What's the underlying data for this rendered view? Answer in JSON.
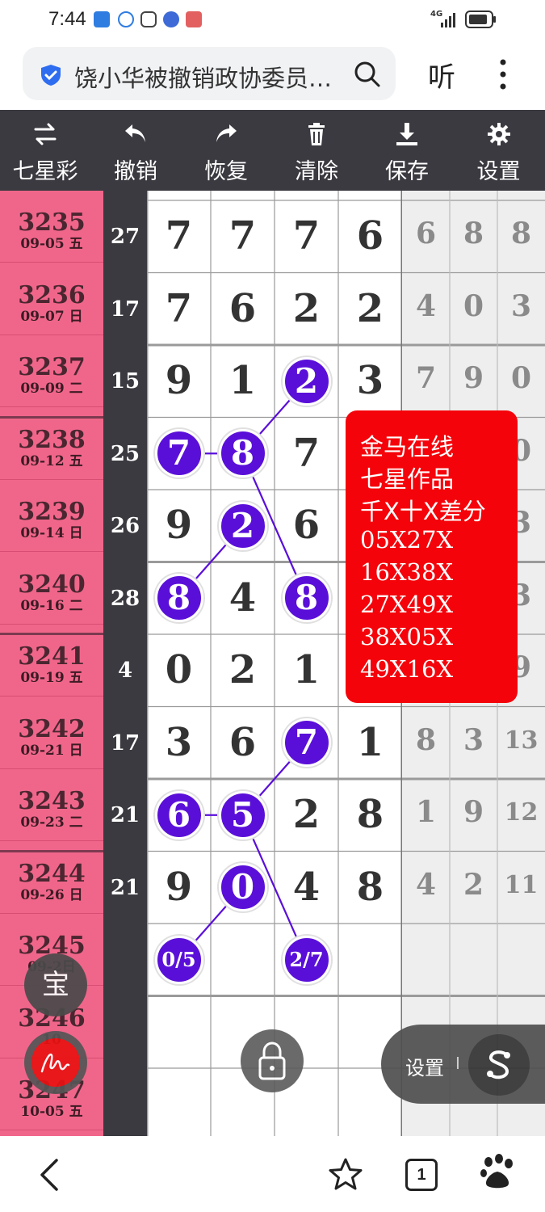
{
  "status_bar": {
    "time": "7:44",
    "network": "4G"
  },
  "browser": {
    "address_title": "饶小华被撤销政协委员…",
    "listen_label": "听"
  },
  "toolbar": [
    {
      "label": "七星彩",
      "icon": "swap-icon"
    },
    {
      "label": "撤销",
      "icon": "undo-icon"
    },
    {
      "label": "恢复",
      "icon": "redo-icon"
    },
    {
      "label": "清除",
      "icon": "trash-icon"
    },
    {
      "label": "保存",
      "icon": "download-icon"
    },
    {
      "label": "设置",
      "icon": "gear-icon"
    }
  ],
  "rows": [
    {
      "period": "3235",
      "date": "09-05 五",
      "sum": "27",
      "digits": [
        "7",
        "7",
        "7",
        "6"
      ],
      "extra": [
        "6",
        "8",
        "8"
      ]
    },
    {
      "period": "3236",
      "date": "09-07 日",
      "sum": "17",
      "digits": [
        "7",
        "6",
        "2",
        "2"
      ],
      "extra": [
        "4",
        "0",
        "3"
      ]
    },
    {
      "period": "3237",
      "date": "09-09 二",
      "sum": "15",
      "digits": [
        "9",
        "1",
        "2",
        "3"
      ],
      "extra": [
        "7",
        "9",
        "0"
      ]
    },
    {
      "period": "3238",
      "date": "09-12 五",
      "sum": "25",
      "digits": [
        "7",
        "8",
        "7",
        ""
      ],
      "extra": [
        "",
        "",
        "0"
      ]
    },
    {
      "period": "3239",
      "date": "09-14 日",
      "sum": "26",
      "digits": [
        "9",
        "2",
        "6",
        ""
      ],
      "extra": [
        "",
        "",
        "3"
      ]
    },
    {
      "period": "3240",
      "date": "09-16 二",
      "sum": "28",
      "digits": [
        "8",
        "4",
        "8",
        ""
      ],
      "extra": [
        "",
        "",
        "3"
      ]
    },
    {
      "period": "3241",
      "date": "09-19 五",
      "sum": "4",
      "digits": [
        "0",
        "2",
        "1",
        ""
      ],
      "extra": [
        "",
        "",
        "9"
      ]
    },
    {
      "period": "3242",
      "date": "09-21 日",
      "sum": "17",
      "digits": [
        "3",
        "6",
        "7",
        "1"
      ],
      "extra": [
        "8",
        "3",
        "13"
      ]
    },
    {
      "period": "3243",
      "date": "09-23 二",
      "sum": "21",
      "digits": [
        "6",
        "5",
        "2",
        "8"
      ],
      "extra": [
        "1",
        "9",
        "12"
      ]
    },
    {
      "period": "3244",
      "date": "09-26 日",
      "sum": "21",
      "digits": [
        "9",
        "0",
        "4",
        "8"
      ],
      "extra": [
        "4",
        "2",
        "11"
      ]
    },
    {
      "period": "3245",
      "date": "09-2日",
      "sum": "",
      "digits": [
        "",
        "",
        "",
        ""
      ],
      "extra": [
        "",
        "",
        ""
      ]
    },
    {
      "period": "3246",
      "date": "10",
      "sum": "",
      "digits": [
        "",
        "",
        "",
        ""
      ],
      "extra": [
        "",
        "",
        ""
      ]
    },
    {
      "period": "3247",
      "date": "10-05 五",
      "sum": "",
      "digits": [
        "",
        "",
        "",
        ""
      ],
      "extra": [
        "",
        "",
        ""
      ]
    }
  ],
  "highlights": [
    {
      "row": 2,
      "col": 2,
      "text": "2"
    },
    {
      "row": 3,
      "col": 0,
      "text": "7"
    },
    {
      "row": 3,
      "col": 1,
      "text": "8"
    },
    {
      "row": 4,
      "col": 1,
      "text": "2"
    },
    {
      "row": 5,
      "col": 0,
      "text": "8"
    },
    {
      "row": 5,
      "col": 2,
      "text": "8"
    },
    {
      "row": 7,
      "col": 2,
      "text": "7"
    },
    {
      "row": 8,
      "col": 0,
      "text": "6"
    },
    {
      "row": 8,
      "col": 1,
      "text": "5"
    },
    {
      "row": 9,
      "col": 1,
      "text": "0"
    },
    {
      "row": 10,
      "col": 0,
      "text": "0/5"
    },
    {
      "row": 10,
      "col": 2,
      "text": "2/7"
    }
  ],
  "popup": {
    "lines": [
      "金马在线",
      "七星作品",
      "千X十X差分"
    ],
    "codes": [
      "05X27X",
      "16X38X",
      "27X49X",
      "38X05X",
      "49X16X"
    ]
  },
  "floats": {
    "bao_label": "宝",
    "settings_label": "设置",
    "settings_bar": "I"
  },
  "colors": {
    "period_bg": "#f0668a",
    "toolbar_bg": "#3a3a40",
    "ball": "#5a0fd9",
    "popup_bg": "#f4040a"
  }
}
